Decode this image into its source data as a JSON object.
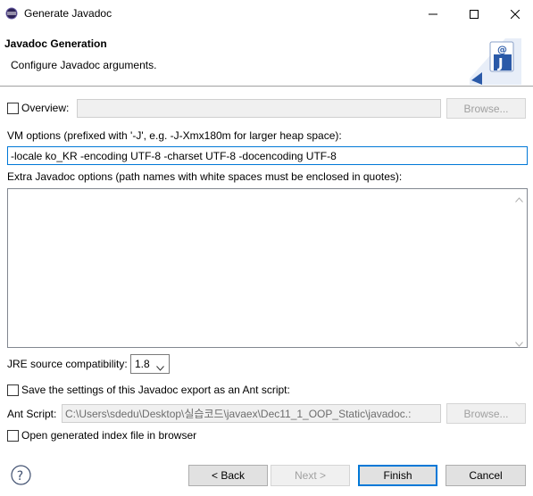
{
  "window": {
    "title": "Generate Javadoc"
  },
  "banner": {
    "title": "Javadoc Generation",
    "description": "Configure Javadoc arguments."
  },
  "overview": {
    "label": "Overview:",
    "checked": false,
    "value": "",
    "browse_label": "Browse..."
  },
  "vm_options": {
    "label": "VM options (prefixed with '-J', e.g. -J-Xmx180m for larger heap space):",
    "value": "-locale ko_KR -encoding UTF-8 -charset UTF-8 -docencoding UTF-8"
  },
  "extra_options": {
    "label": "Extra Javadoc options (path names with white spaces must be enclosed in quotes):",
    "value": ""
  },
  "jre": {
    "label": "JRE source compatibility:",
    "selected": "1.8"
  },
  "ant": {
    "save_label": "Save the settings of this Javadoc export as an Ant script:",
    "save_checked": false,
    "script_label": "Ant Script:",
    "script_value": "C:\\Users\\sdedu\\Desktop\\실습코드\\javaex\\Dec11_1_OOP_Static\\javadoc.:",
    "browse_label": "Browse..."
  },
  "open_index": {
    "label": "Open generated index file in browser",
    "checked": false
  },
  "buttons": {
    "back": "< Back",
    "next": "Next >",
    "finish": "Finish",
    "cancel": "Cancel"
  },
  "icons": {
    "app": "eclipse-icon",
    "banner": "javadoc-wizard-icon",
    "help": "help-icon"
  },
  "colors": {
    "default_button_border": "#0078d7",
    "banner_icon_blue": "#2b5aa8"
  }
}
